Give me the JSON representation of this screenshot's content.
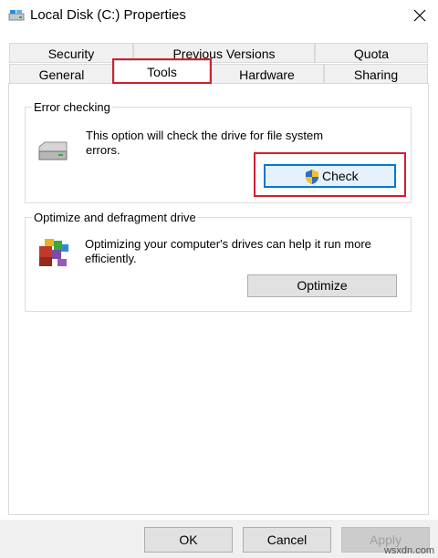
{
  "window": {
    "title": "Local Disk (C:) Properties",
    "icon": "drive-icon",
    "close_icon": "close-icon"
  },
  "tabs": {
    "row1": [
      "Security",
      "Previous Versions",
      "Quota"
    ],
    "row2": [
      "General",
      "Tools",
      "Hardware",
      "Sharing"
    ],
    "selected": "Tools"
  },
  "error_checking": {
    "title": "Error checking",
    "description": "This option will check the drive for file system errors.",
    "button_label": "Check",
    "button_icon": "uac-shield-icon"
  },
  "optimize": {
    "title": "Optimize and defragment drive",
    "description": "Optimizing your computer's drives can help it run more efficiently.",
    "button_label": "Optimize",
    "icon": "defrag-icon"
  },
  "footer": {
    "ok_label": "OK",
    "cancel_label": "Cancel",
    "apply_label": "Apply"
  },
  "watermark": "wsxdn.com",
  "colors": {
    "highlight": "#d0202d",
    "focus": "#0078d7"
  }
}
